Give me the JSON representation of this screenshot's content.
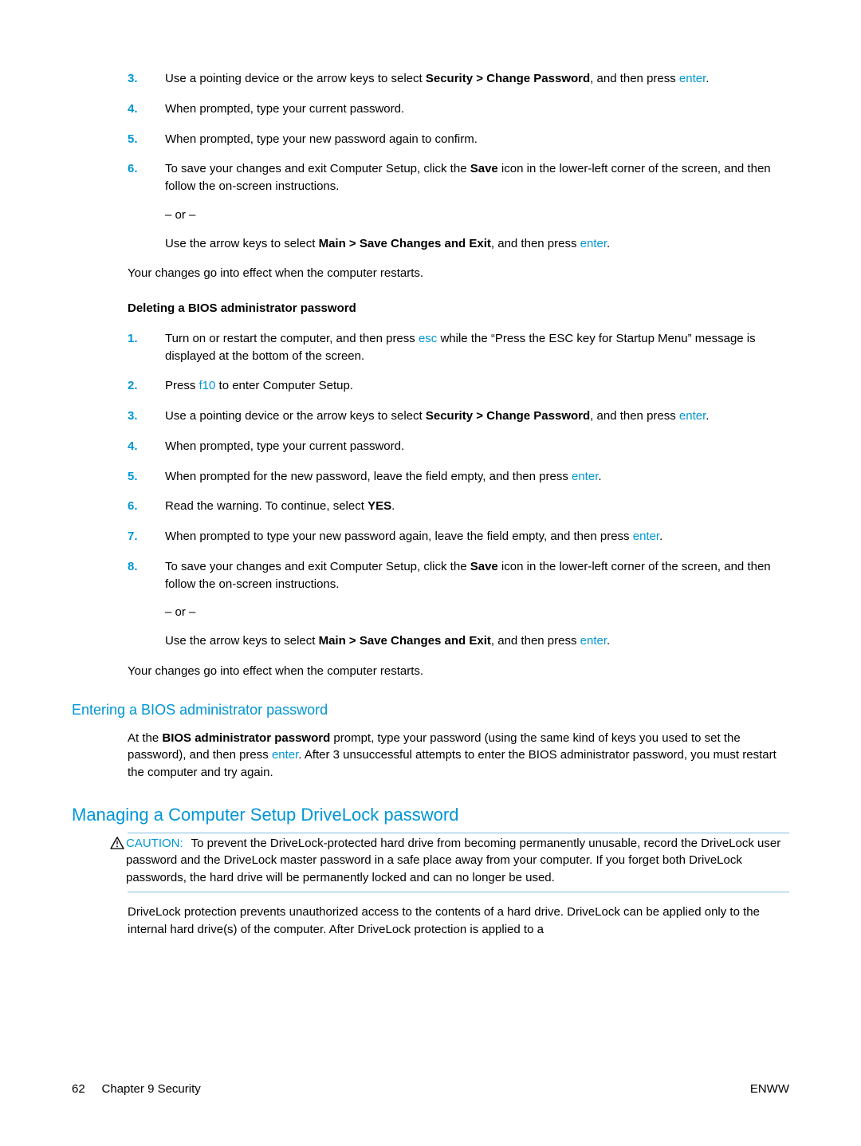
{
  "list1": {
    "items": [
      {
        "num": "3.",
        "pre": "Use a pointing device or the arrow keys to select ",
        "bold1": "Security > Change Password",
        "mid": ", and then press ",
        "blue1": "enter",
        "post": "."
      },
      {
        "num": "4.",
        "text": "When prompted, type your current password."
      },
      {
        "num": "5.",
        "text": "When prompted, type your new password again to confirm."
      },
      {
        "num": "6.",
        "pre": "To save your changes and exit Computer Setup, click the ",
        "bold1": "Save",
        "post": " icon in the lower-left corner of the screen, and then follow the on-screen instructions.",
        "or": "– or –",
        "alt_pre": "Use the arrow keys to select ",
        "alt_bold": "Main > Save Changes and Exit",
        "alt_mid": ", and then press ",
        "alt_blue": "enter",
        "alt_post": "."
      }
    ],
    "closing": "Your changes go into effect when the computer restarts."
  },
  "section2": {
    "heading": "Deleting a BIOS administrator password",
    "items": [
      {
        "num": "1.",
        "pre": "Turn on or restart the computer, and then press ",
        "blue1": "esc",
        "post": " while the “Press the ESC key for Startup Menu” message is displayed at the bottom of the screen."
      },
      {
        "num": "2.",
        "pre": "Press ",
        "blue1": "f10",
        "post": " to enter Computer Setup."
      },
      {
        "num": "3.",
        "pre": "Use a pointing device or the arrow keys to select ",
        "bold1": "Security > Change Password",
        "mid": ", and then press ",
        "blue1": "enter",
        "post": "."
      },
      {
        "num": "4.",
        "text": "When prompted, type your current password."
      },
      {
        "num": "5.",
        "pre": "When prompted for the new password, leave the field empty, and then press ",
        "blue1": "enter",
        "post": "."
      },
      {
        "num": "6.",
        "pre": "Read the warning. To continue, select ",
        "bold1": "YES",
        "post": "."
      },
      {
        "num": "7.",
        "pre": "When prompted to type your new password again, leave the field empty, and then press ",
        "blue1": "enter",
        "post": "."
      },
      {
        "num": "8.",
        "pre": "To save your changes and exit Computer Setup, click the ",
        "bold1": "Save",
        "post": " icon in the lower-left corner of the screen, and then follow the on-screen instructions.",
        "or": "– or –",
        "alt_pre": "Use the arrow keys to select ",
        "alt_bold": "Main > Save Changes and Exit",
        "alt_mid": ", and then press ",
        "alt_blue": "enter",
        "alt_post": "."
      }
    ],
    "closing": "Your changes go into effect when the computer restarts."
  },
  "h3": {
    "title": "Entering a BIOS administrator password",
    "para_pre": "At the ",
    "para_bold": "BIOS administrator password",
    "para_mid": " prompt, type your password (using the same kind of keys you used to set the password), and then press ",
    "para_blue": "enter",
    "para_post": ". After 3 unsuccessful attempts to enter the BIOS administrator password, you must restart the computer and try again."
  },
  "h2": {
    "title": "Managing a Computer Setup DriveLock password",
    "caution_label": "CAUTION:",
    "caution_text": "To prevent the DriveLock-protected hard drive from becoming permanently unusable, record the DriveLock user password and the DriveLock master password in a safe place away from your computer. If you forget both DriveLock passwords, the hard drive will be permanently locked and can no longer be used.",
    "para": "DriveLock protection prevents unauthorized access to the contents of a hard drive. DriveLock can be applied only to the internal hard drive(s) of the computer. After DriveLock protection is applied to a"
  },
  "footer": {
    "page_num": "62",
    "chapter": "Chapter 9   Security",
    "right": "ENWW"
  }
}
